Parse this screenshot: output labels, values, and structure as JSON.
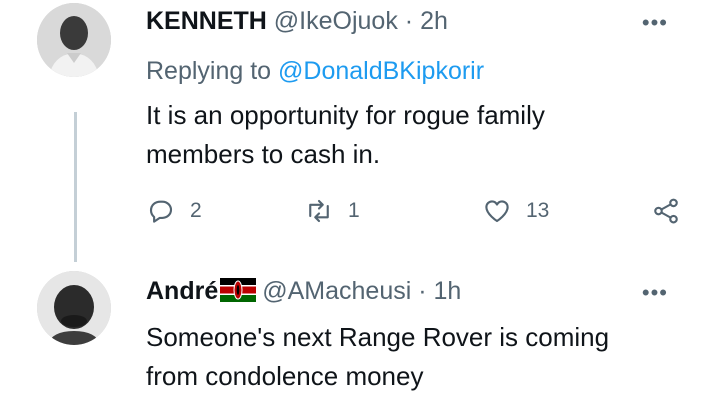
{
  "tweets": [
    {
      "name": "KENNETH",
      "handle": "@IkeOjuok",
      "separator": "·",
      "time": "2h",
      "replying_prefix": "Replying to",
      "replying_to": "@DonaldBKipkorir",
      "text_line1": "It is an opportunity for rogue family",
      "text_line2": "members to cash in.",
      "replies": "2",
      "retweets": "1",
      "likes": "13",
      "more": "•••"
    },
    {
      "name": "André",
      "handle": "@AMacheusi",
      "separator": "·",
      "time": "1h",
      "flag": "kenya-flag",
      "text_line1": "Someone's next Range Rover is coming",
      "text_line2": "from condolence money",
      "more": "•••"
    }
  ],
  "colors": {
    "link": "#1d9bf0",
    "muted": "#536471",
    "thread_line": "#c4cfd6"
  }
}
